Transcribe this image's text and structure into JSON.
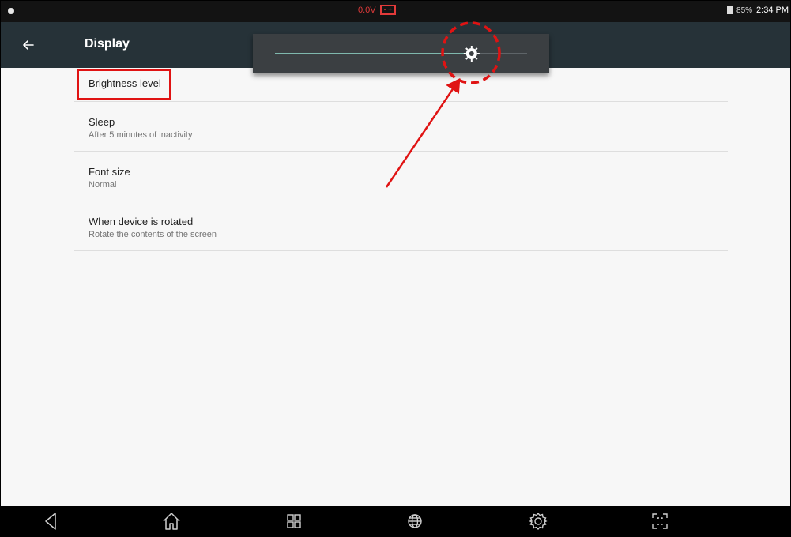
{
  "status_bar": {
    "voltage": "0.0V",
    "battery_percent": "85%",
    "time": "2:34 PM",
    "icons": [
      "notification-dot-icon",
      "car-battery-icon",
      "battery-icon"
    ]
  },
  "app_bar": {
    "title": "Display",
    "back_icon": "arrow-left-icon"
  },
  "brightness_popup": {
    "level": 0.78,
    "track_color": "#7fb8ad",
    "thumb_icon": "brightness-sun-icon"
  },
  "settings": [
    {
      "title": "Brightness level",
      "subtitle": ""
    },
    {
      "title": "Sleep",
      "subtitle": "After 5 minutes of inactivity"
    },
    {
      "title": "Font size",
      "subtitle": "Normal"
    },
    {
      "title": "When device is rotated",
      "subtitle": "Rotate the contents of the screen"
    }
  ],
  "annotation_color": "#e01313",
  "nav_bar": {
    "icons": [
      "back-triangle-icon",
      "home-icon",
      "recent-apps-icon",
      "globe-icon",
      "settings-gear-icon",
      "screenshot-icon"
    ]
  }
}
